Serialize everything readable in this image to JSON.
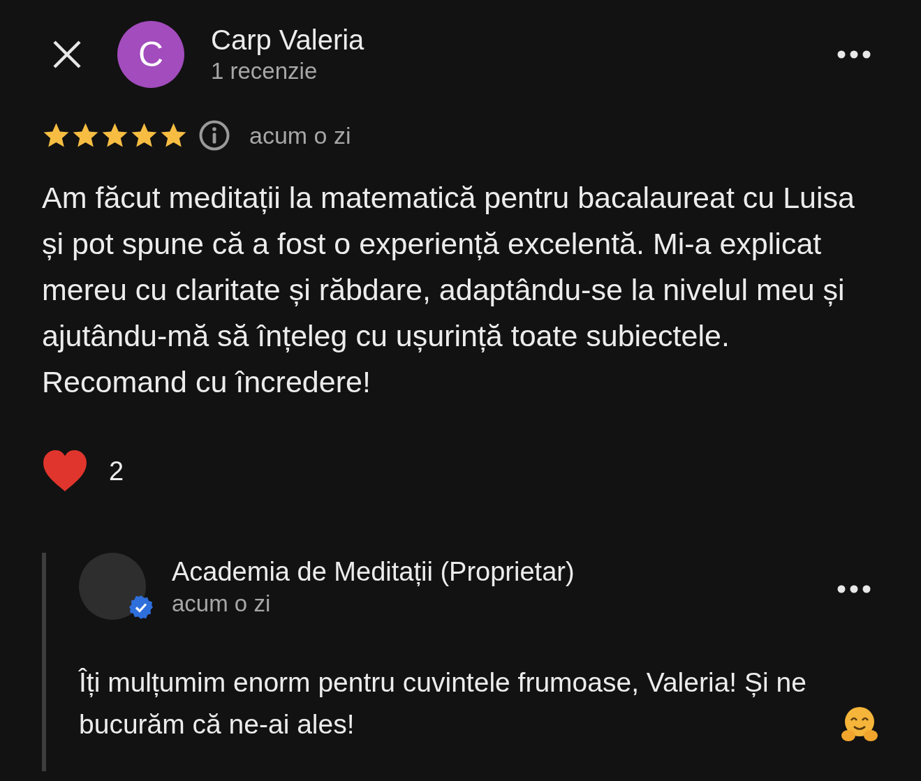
{
  "reviewer": {
    "initial": "C",
    "name": "Carp Valeria",
    "review_count": "1 recenzie"
  },
  "review": {
    "stars": 5,
    "time": "acum o zi",
    "text": "Am făcut meditații la matematică pentru bacalaureat cu Luisa și pot spune că a fost o experiență excelentă. Mi-a explicat mereu cu claritate și răbdare, adaptându-se la nivelul meu și ajutându-mă să înțeleg cu ușurință toate subiectele. Recomand cu încredere!"
  },
  "reactions": {
    "count": "2"
  },
  "owner_reply": {
    "name": "Academia de Meditații (Proprietar)",
    "verified": true,
    "time": "acum o zi",
    "text": "Îți mulțumim enorm pentru cuvintele frumoase, Valeria! Și ne bucurăm că ne-ai ales!"
  }
}
